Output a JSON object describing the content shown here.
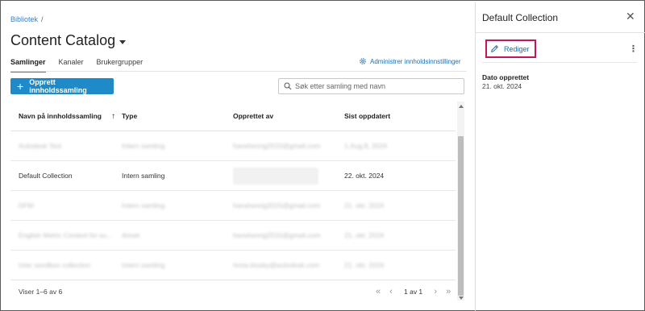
{
  "breadcrumb": {
    "item": "Bibliotek",
    "separator": "/"
  },
  "page_title": "Content Catalog",
  "tabs": [
    {
      "label": "Samlinger",
      "active": true
    },
    {
      "label": "Kanaler",
      "active": false
    },
    {
      "label": "Brukergrupper",
      "active": false
    }
  ],
  "admin_link": "Administrer innholdsinnstillinger",
  "create_button": {
    "icon": "plus",
    "label": "Opprett innholdssamling"
  },
  "search": {
    "placeholder": "Søk etter samling med navn",
    "value": ""
  },
  "table": {
    "columns": [
      "Navn på innholdssamling",
      "Type",
      "Opprettet av",
      "Sist oppdatert"
    ],
    "sort_indicator": "↑",
    "rows": [
      {
        "name": "Autodesk Test",
        "type": "Intern samling",
        "creator": "hanshenrig2015@gmail.com",
        "updated": "1.Aug.8, 2024",
        "obscured": true
      },
      {
        "name": "Default Collection",
        "type": "Intern samling",
        "creator": "",
        "updated": "22. okt. 2024",
        "obscured": false
      },
      {
        "name": "DFM",
        "type": "Intern samling",
        "creator": "hanshenrig2015@gmail.com",
        "updated": "21. okt. 2024",
        "obscured": true
      },
      {
        "name": "English Metric Content for su...",
        "type": "Annet",
        "creator": "hanshenrig2015@gmail.com",
        "updated": "21. okt. 2024",
        "obscured": true
      },
      {
        "name": "Inter sandbox collection",
        "type": "Intern samling",
        "creator": "hnna.kiosby@autodesk.com",
        "updated": "21. okt. 2024",
        "obscured": true
      }
    ]
  },
  "footer": {
    "count_text": "Viser 1–6 av 6",
    "page_label": "1 av 1"
  },
  "panel": {
    "title": "Default Collection",
    "edit_label": "Rediger",
    "meta_label": "Dato opprettet",
    "meta_value": "21. okt. 2024"
  },
  "colors": {
    "accent": "#1e8ac8",
    "link": "#1e6db1",
    "highlight_border": "#c2185b"
  }
}
